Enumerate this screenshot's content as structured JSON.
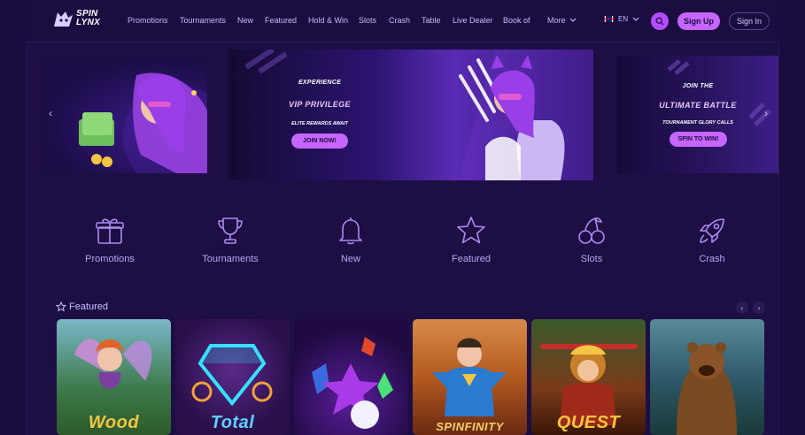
{
  "brand": {
    "logo_line1": "SPIN",
    "logo_line2": "LYNX"
  },
  "nav": {
    "items": [
      {
        "label": "Promotions"
      },
      {
        "label": "Tournaments"
      },
      {
        "label": "New"
      },
      {
        "label": "Featured"
      },
      {
        "label": "Hold & Win"
      },
      {
        "label": "Slots"
      },
      {
        "label": "Crash"
      },
      {
        "label": "Table"
      },
      {
        "label": "Live Dealer"
      },
      {
        "label": "Book of"
      }
    ],
    "more_label": "More"
  },
  "header": {
    "language": "EN",
    "signup_label": "Sign Up",
    "signin_label": "Sign In"
  },
  "banners": {
    "center": {
      "line1": "EXPERIENCE",
      "line2": "VIP PRIVILEGE",
      "line3": "ELITE REWARDS AWAIT",
      "button": "JOIN NOW!"
    },
    "right": {
      "line1": "JOIN THE",
      "line2": "ULTIMATE BATTLE",
      "line3": "TOURNAMENT GLORY CALLS",
      "button": "SPIN TO WIN!"
    }
  },
  "categories": [
    {
      "label": "Promotions",
      "icon": "gift-icon"
    },
    {
      "label": "Tournaments",
      "icon": "trophy-icon"
    },
    {
      "label": "New",
      "icon": "bell-icon"
    },
    {
      "label": "Featured",
      "icon": "star-icon"
    },
    {
      "label": "Slots",
      "icon": "cherries-icon"
    },
    {
      "label": "Crash",
      "icon": "rocket-icon"
    }
  ],
  "featured": {
    "title": "Featured",
    "games": [
      {
        "title": "Wood",
        "bg": "#3d7a4a"
      },
      {
        "title": "Total",
        "bg": "#2a0f4a"
      },
      {
        "title": "",
        "bg": "#2a0b55"
      },
      {
        "title": "SPINFINITY",
        "bg": "#b35a1f"
      },
      {
        "title": "QUEST",
        "bg": "#5a2a12"
      },
      {
        "title": "",
        "bg": "#2f5a6a"
      }
    ]
  },
  "colors": {
    "accent": "#c765ff",
    "background": "#1d0e44",
    "text": "#b9a8ee"
  }
}
